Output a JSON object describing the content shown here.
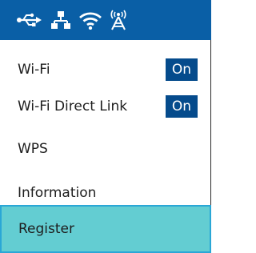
{
  "status_bar": {
    "icons": [
      "usb-icon",
      "network-icon",
      "wifi-icon",
      "wifi-direct-icon"
    ]
  },
  "menu": {
    "items": [
      {
        "label": "Wi-Fi",
        "toggle": "On"
      },
      {
        "label": "Wi-Fi Direct Link",
        "toggle": "On"
      },
      {
        "label": "WPS"
      },
      {
        "label": "Information"
      },
      {
        "label": "Register"
      }
    ],
    "selected_index": 4
  },
  "colors": {
    "topbar": "#0a5fa6",
    "toggle": "#054b8c",
    "selected": "#63cdd2",
    "selected_border": "#2aa7d6"
  }
}
